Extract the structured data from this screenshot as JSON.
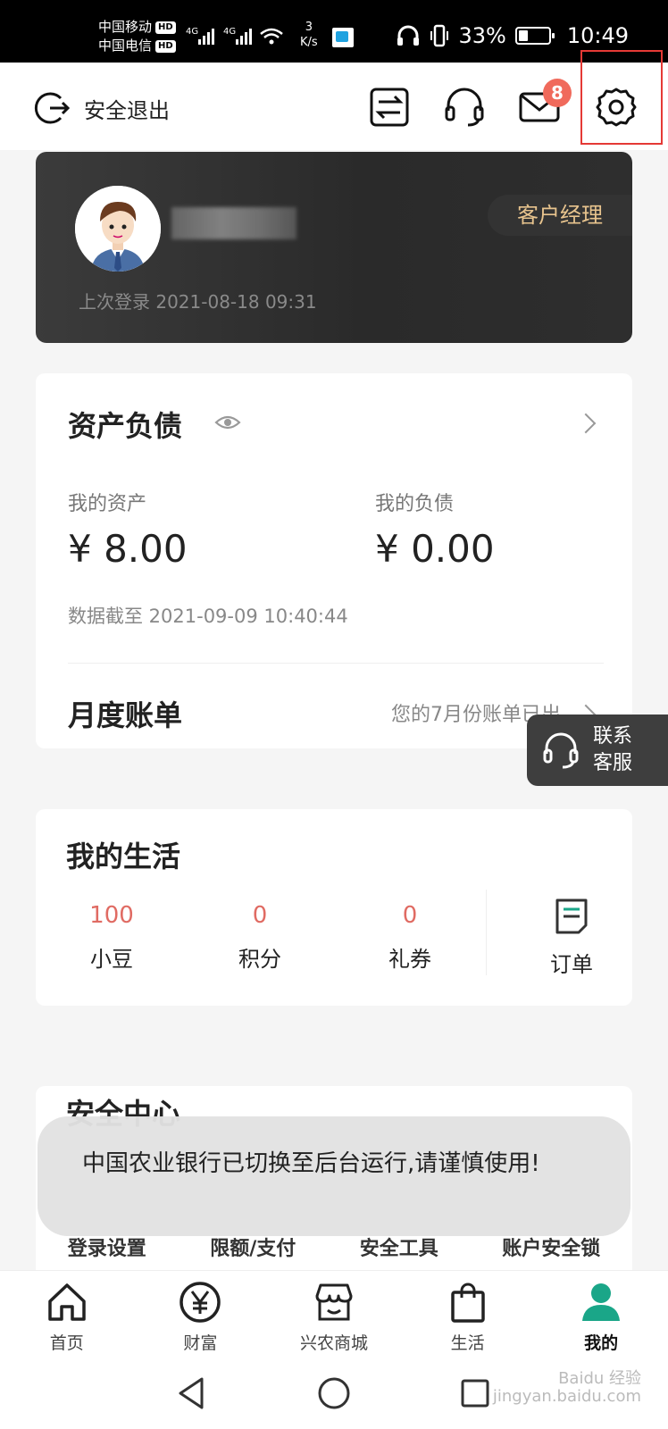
{
  "status_bar": {
    "carrier1": "中国移动",
    "carrier2": "中国电信",
    "hd": "HD",
    "net1": "4G",
    "net2": "4G",
    "speed_value": "3",
    "speed_unit": "K/s",
    "battery": "33%",
    "time": "10:49"
  },
  "header": {
    "logout_label": "安全退出",
    "mail_badge": "8",
    "icons": [
      "transfer-icon",
      "headset-icon",
      "mail-icon",
      "settings-icon"
    ]
  },
  "profile": {
    "manager_label": "客户经理",
    "last_login": "上次登录 2021-08-18 09:31"
  },
  "assets": {
    "title": "资产负债",
    "my_assets_label": "我的资产",
    "my_assets_value": "¥ 8.00",
    "my_liabilities_label": "我的负债",
    "my_liabilities_value": "¥ 0.00",
    "data_as_of": "数据截至 2021-09-09 10:40:44",
    "monthly_bill_title": "月度账单",
    "monthly_bill_note": "您的7月份账单已出"
  },
  "float_service": {
    "line1": "联系",
    "line2": "客服"
  },
  "life": {
    "title": "我的生活",
    "items": [
      {
        "value": "100",
        "label": "小豆"
      },
      {
        "value": "0",
        "label": "积分"
      },
      {
        "value": "0",
        "label": "礼券"
      }
    ],
    "order_label": "订单"
  },
  "security": {
    "title": "安全中心",
    "items": [
      "登录设置",
      "限额/支付",
      "安全工具",
      "账户安全锁"
    ]
  },
  "toast": {
    "text": "中国农业银行已切换至后台运行,请谨慎使用!"
  },
  "bottom_nav": {
    "items": [
      {
        "label": "首页",
        "icon": "home-icon"
      },
      {
        "label": "财富",
        "icon": "yen-icon"
      },
      {
        "label": "兴农商城",
        "icon": "store-icon"
      },
      {
        "label": "生活",
        "icon": "bag-icon"
      },
      {
        "label": "我的",
        "icon": "user-icon"
      }
    ],
    "active_index": 4
  },
  "watermark": {
    "line1": "Baidu 经验",
    "line2": "jingyan.baidu.com"
  },
  "colors": {
    "accent_green": "#1aa688",
    "badge_red": "#f06a5c",
    "value_red": "#e06b63",
    "manager_gold": "#e8c48e"
  }
}
